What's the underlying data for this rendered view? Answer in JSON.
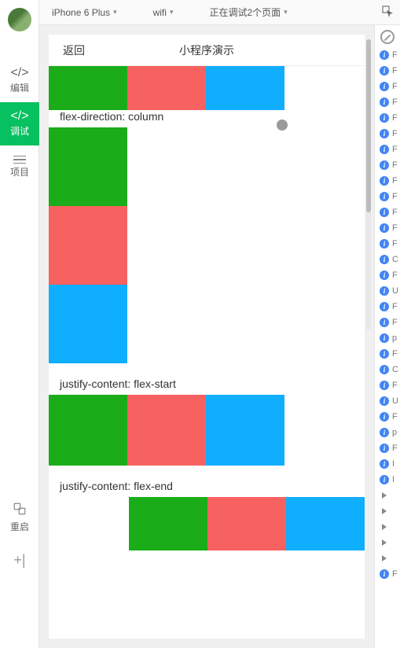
{
  "sidebar": {
    "items": [
      {
        "label": "编辑"
      },
      {
        "label": "调试"
      },
      {
        "label": "项目"
      },
      {
        "label": "重启"
      }
    ]
  },
  "toolbar": {
    "device": "iPhone 6 Plus",
    "network": "wifi",
    "status": "正在调试2个页面"
  },
  "nav": {
    "back": "返回",
    "title": "小程序演示"
  },
  "sections": {
    "s1": "flex-direction: column",
    "s2": "justify-content: flex-start",
    "s3": "justify-content: flex-end"
  },
  "log": {
    "items": [
      "F",
      "F",
      "F",
      "F",
      "F",
      "F",
      "F",
      "F",
      "F",
      "F",
      "F",
      "F",
      "F",
      "C",
      "F",
      "U",
      "F",
      "F",
      "p",
      "F",
      "C",
      "F",
      "U",
      "F",
      "p",
      "F",
      "I",
      "I",
      "",
      "",
      "",
      "",
      "",
      "F"
    ]
  }
}
